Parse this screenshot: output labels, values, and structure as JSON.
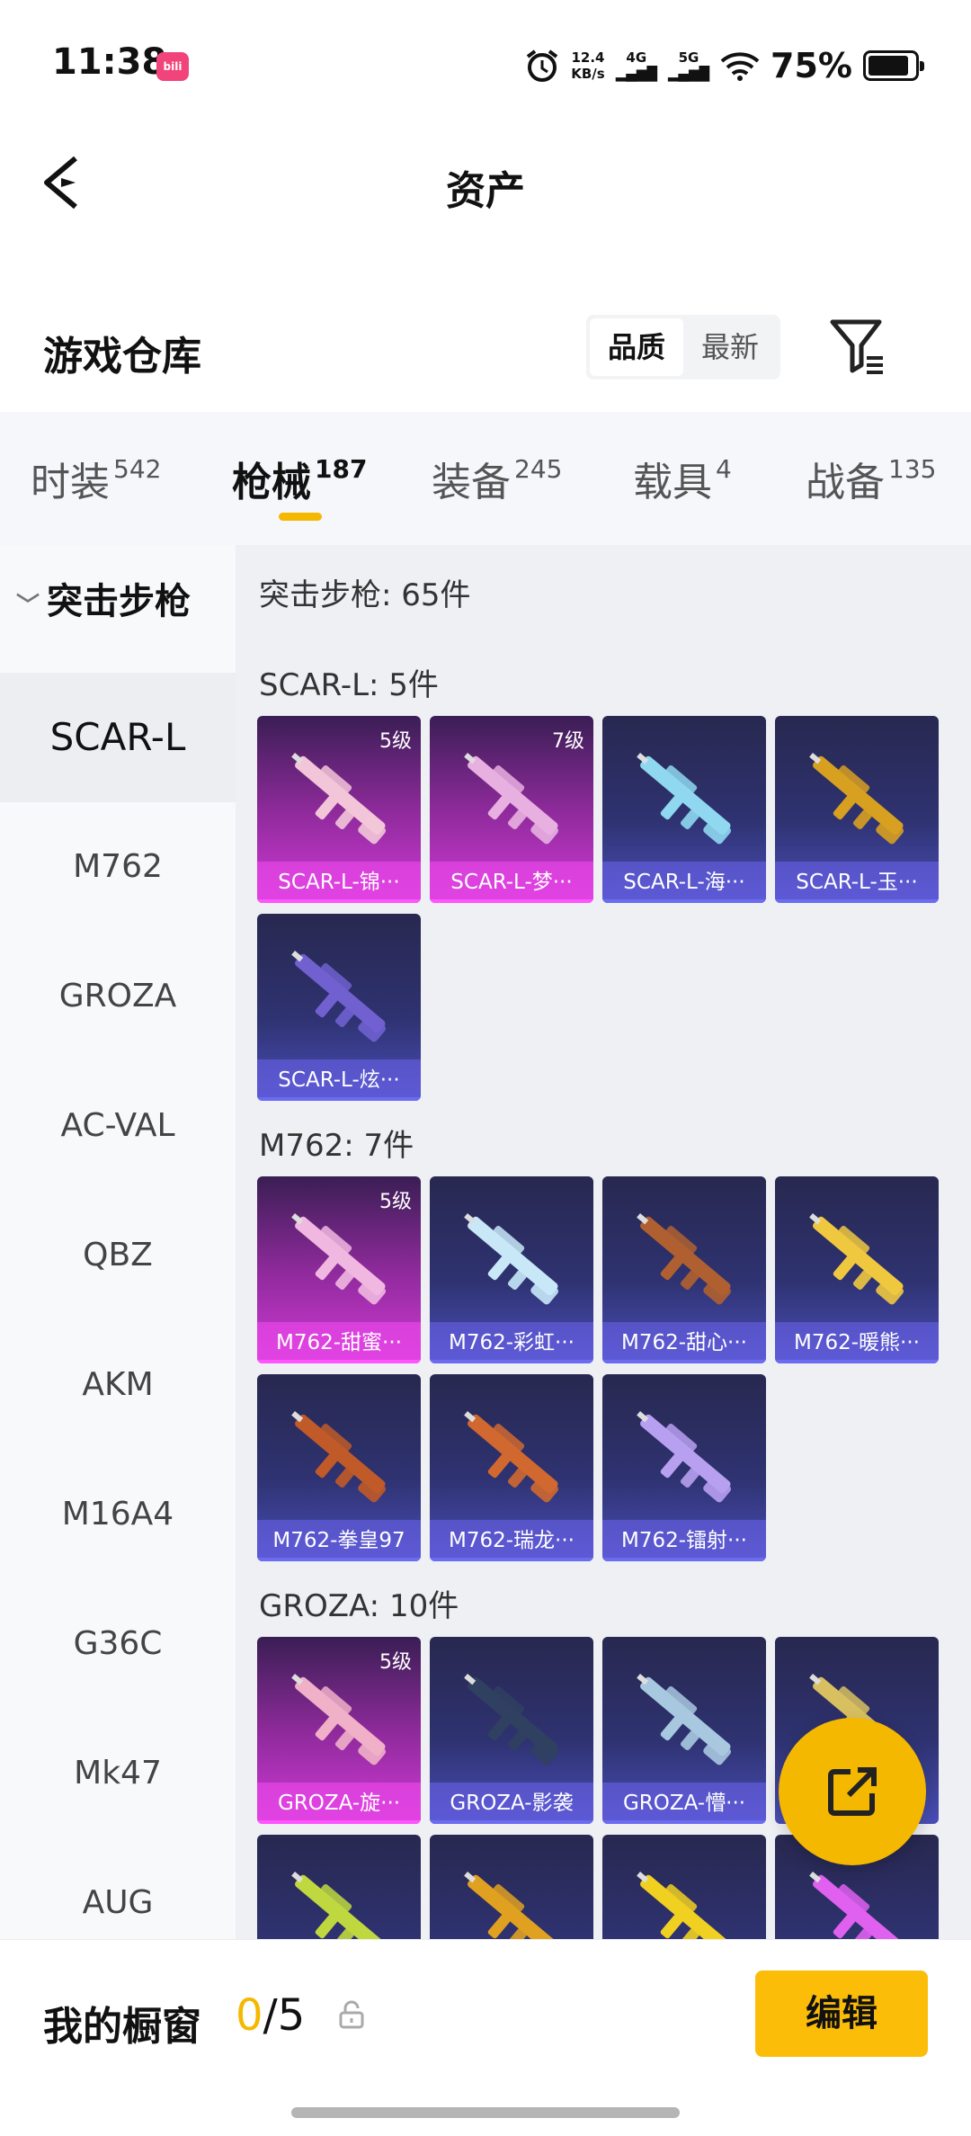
{
  "status_bar": {
    "time": "11:38",
    "app_badge": "bilibili",
    "net_speed_top": "12.4",
    "net_speed_unit": "KB/s",
    "signal_a": "4G",
    "signal_b": "5G",
    "battery": "75%"
  },
  "header": {
    "title": "资产"
  },
  "warehouse": {
    "title": "游戏仓库",
    "sort_options": [
      "品质",
      "最新"
    ]
  },
  "tabs": [
    {
      "label": "时装",
      "count": "542"
    },
    {
      "label": "枪械",
      "count": "187"
    },
    {
      "label": "装备",
      "count": "245"
    },
    {
      "label": "载具",
      "count": "4"
    },
    {
      "label": "战备",
      "count": "135"
    }
  ],
  "sidebar": {
    "category": "突击步枪",
    "items": [
      "SCAR-L",
      "M762",
      "GROZA",
      "AC-VAL",
      "QBZ",
      "AKM",
      "M16A4",
      "G36C",
      "Mk47",
      "AUG"
    ]
  },
  "content": {
    "summary": "突击步枪: 65件",
    "sections": [
      {
        "title": "SCAR-L: 5件",
        "cards": [
          {
            "name": "SCAR-L-锦···",
            "level": "5级",
            "quality": "pink"
          },
          {
            "name": "SCAR-L-梦···",
            "level": "7级",
            "quality": "pink"
          },
          {
            "name": "SCAR-L-海···",
            "level": "",
            "quality": "blue"
          },
          {
            "name": "SCAR-L-玉···",
            "level": "",
            "quality": "blue"
          },
          {
            "name": "SCAR-L-炫···",
            "level": "",
            "quality": "blue"
          }
        ]
      },
      {
        "title": "M762: 7件",
        "cards": [
          {
            "name": "M762-甜蜜···",
            "level": "5级",
            "quality": "pink"
          },
          {
            "name": "M762-彩虹···",
            "level": "",
            "quality": "blue"
          },
          {
            "name": "M762-甜心···",
            "level": "",
            "quality": "blue"
          },
          {
            "name": "M762-暖熊···",
            "level": "",
            "quality": "blue"
          },
          {
            "name": "M762-拳皇97",
            "level": "",
            "quality": "blue"
          },
          {
            "name": "M762-瑞龙···",
            "level": "",
            "quality": "blue"
          },
          {
            "name": "M762-镭射···",
            "level": "",
            "quality": "blue"
          }
        ]
      },
      {
        "title": "GROZA: 10件",
        "cards": [
          {
            "name": "GROZA-旋···",
            "level": "5级",
            "quality": "pink"
          },
          {
            "name": "GROZA-影袭",
            "level": "",
            "quality": "blue"
          },
          {
            "name": "GROZA-懵···",
            "level": "",
            "quality": "blue"
          },
          {
            "name": "",
            "level": "",
            "quality": "blue"
          },
          {
            "name": "",
            "level": "",
            "quality": "blue"
          },
          {
            "name": "",
            "level": "",
            "quality": "blue"
          },
          {
            "name": "",
            "level": "",
            "quality": "blue"
          },
          {
            "name": "",
            "level": "",
            "quality": "blue"
          }
        ]
      }
    ]
  },
  "bottom": {
    "label": "我的橱窗",
    "current": "0",
    "total": "/5",
    "edit": "编辑"
  },
  "colors": {
    "accent": "#f5b800",
    "pink_card": "#d13ad6",
    "blue_card": "#2e3270"
  }
}
